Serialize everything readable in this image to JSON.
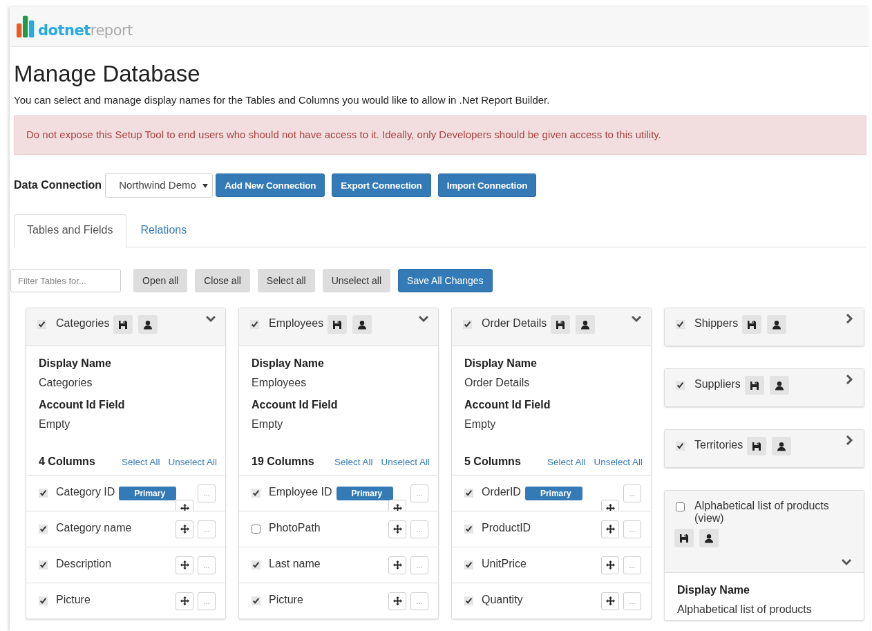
{
  "brand": {
    "name_bold": "dotnet",
    "name_light": "report"
  },
  "page": {
    "title": "Manage Database",
    "subtitle": "You can select and manage display names for the Tables and Columns you would like to allow in .Net Report Builder.",
    "alert": "Do not expose this Setup Tool to end users who should not have access to it. Ideally, only Developers should be given access to this utility."
  },
  "connection": {
    "label": "Data Connection",
    "value": "Northwind Demo",
    "buttons": [
      "Add New Connection",
      "Export Connection",
      "Import Connection"
    ]
  },
  "tabs": [
    {
      "label": "Tables and Fields",
      "selected": true
    },
    {
      "label": "Relations",
      "selected": false
    }
  ],
  "toolbar": {
    "filter_placeholder": "Filter Tables for...",
    "buttons": [
      {
        "label": "Open all",
        "kind": "default"
      },
      {
        "label": "Close all",
        "kind": "default"
      },
      {
        "label": "Select all",
        "kind": "default"
      },
      {
        "label": "Unselect all",
        "kind": "default"
      },
      {
        "label": "Save All Changes",
        "kind": "primary"
      }
    ]
  },
  "table_columns": [
    {
      "tables": [
        {
          "name": "Categories",
          "checked": true,
          "expanded": true,
          "display_name_label": "Display Name",
          "display_name": "Categories",
          "account_label": "Account Id Field",
          "account_value": "Empty",
          "column_count": "4 Columns",
          "select_all": "Select All",
          "unselect_all": "Unselect All",
          "more": "...",
          "fields": [
            {
              "name": "Category ID",
              "checked": true,
              "badge": "Primary"
            },
            {
              "name": "Category name",
              "checked": true
            },
            {
              "name": "Description",
              "checked": true
            },
            {
              "name": "Picture",
              "checked": true
            }
          ]
        }
      ]
    },
    {
      "tables": [
        {
          "name": "Employees",
          "checked": true,
          "expanded": true,
          "display_name_label": "Display Name",
          "display_name": "Employees",
          "account_label": "Account Id Field",
          "account_value": "Empty",
          "column_count": "19 Columns",
          "select_all": "Select All",
          "unselect_all": "Unselect All",
          "more": "...",
          "fields": [
            {
              "name": "Employee ID",
              "checked": true,
              "badge": "Primary"
            },
            {
              "name": "PhotoPath",
              "checked": false
            },
            {
              "name": "Last name",
              "checked": true
            },
            {
              "name": "Picture",
              "checked": true
            }
          ]
        }
      ]
    },
    {
      "tables": [
        {
          "name": "Order Details",
          "checked": true,
          "expanded": true,
          "display_name_label": "Display Name",
          "display_name": "Order Details",
          "account_label": "Account Id Field",
          "account_value": "Empty",
          "column_count": "5 Columns",
          "select_all": "Select All",
          "unselect_all": "Unselect All",
          "more": "...",
          "fields": [
            {
              "name": "OrderID",
              "checked": true,
              "badge": "Primary"
            },
            {
              "name": "ProductID",
              "checked": true
            },
            {
              "name": "UnitPrice",
              "checked": true
            },
            {
              "name": "Quantity",
              "checked": true
            }
          ]
        }
      ]
    },
    {
      "tables": [
        {
          "name": "Shippers",
          "checked": true,
          "expanded": false
        },
        {
          "name": "Suppliers",
          "checked": true,
          "expanded": false
        },
        {
          "name": "Territories",
          "checked": true,
          "expanded": false
        },
        {
          "name": "Alphabetical list of products (view)",
          "checked": false,
          "expanded": true,
          "display_name_label": "Display Name",
          "display_name": "Alphabetical list of products"
        }
      ]
    }
  ]
}
